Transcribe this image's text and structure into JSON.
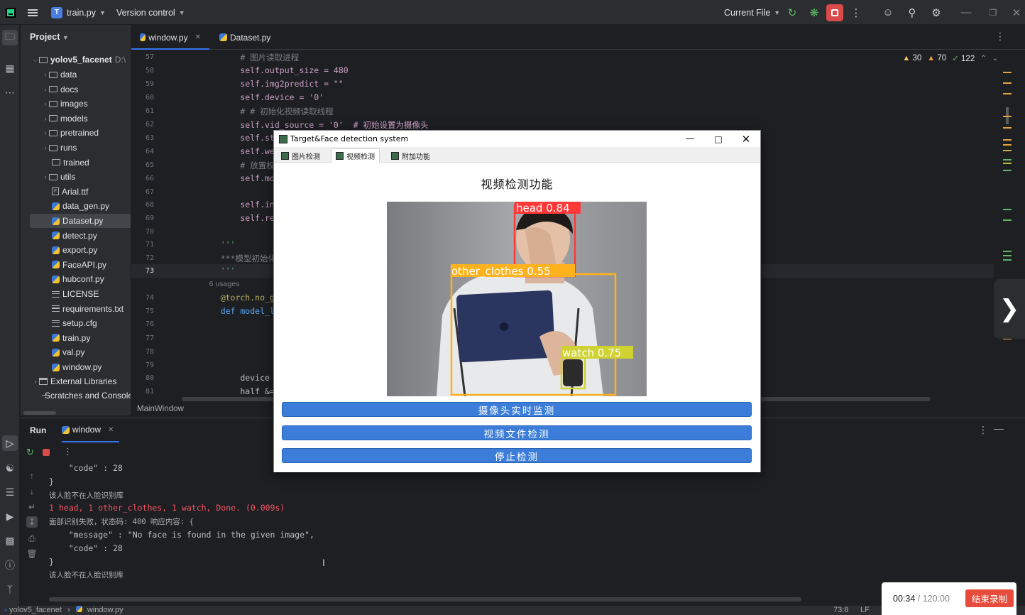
{
  "titlebar": {
    "project_badge": "T",
    "project_name": "train.py",
    "vcs": "Version control",
    "run_config": "Current File"
  },
  "project_panel": {
    "title": "Project",
    "root": {
      "name": "yolov5_facenet",
      "path": "D:\\"
    },
    "items": [
      {
        "label": "data",
        "type": "folder"
      },
      {
        "label": "docs",
        "type": "folder"
      },
      {
        "label": "images",
        "type": "folder"
      },
      {
        "label": "models",
        "type": "folder"
      },
      {
        "label": "pretrained",
        "type": "folder"
      },
      {
        "label": "runs",
        "type": "folder"
      },
      {
        "label": "trained",
        "type": "folder-noarrow"
      },
      {
        "label": "utils",
        "type": "folder"
      },
      {
        "label": "Arial.ttf",
        "type": "font"
      },
      {
        "label": "data_gen.py",
        "type": "py"
      },
      {
        "label": "Dataset.py",
        "type": "py",
        "selected": true
      },
      {
        "label": "detect.py",
        "type": "py"
      },
      {
        "label": "export.py",
        "type": "py"
      },
      {
        "label": "FaceAPI.py",
        "type": "py"
      },
      {
        "label": "hubconf.py",
        "type": "py"
      },
      {
        "label": "LICENSE",
        "type": "txt"
      },
      {
        "label": "requirements.txt",
        "type": "txt"
      },
      {
        "label": "setup.cfg",
        "type": "txt"
      },
      {
        "label": "train.py",
        "type": "py"
      },
      {
        "label": "val.py",
        "type": "py"
      },
      {
        "label": "window.py",
        "type": "py"
      }
    ],
    "external": "External Libraries",
    "scratches": "Scratches and Consoles"
  },
  "editor": {
    "tabs": [
      {
        "label": "window.py",
        "active": true
      },
      {
        "label": "Dataset.py",
        "active": false
      }
    ],
    "warnings": {
      "w1": "30",
      "w2": "70",
      "ok": "122"
    },
    "lines": [
      {
        "n": "57",
        "t": "        # 图片读取进程"
      },
      {
        "n": "58",
        "t": "        self.output_size = 480"
      },
      {
        "n": "59",
        "t": "        self.img2predict = \"\""
      },
      {
        "n": "60",
        "t": "        self.device = '0'"
      },
      {
        "n": "61",
        "t": "        # # 初始化视频读取线程"
      },
      {
        "n": "62",
        "t": "        self.vid_source = '0'  # 初始设置为摄像头"
      },
      {
        "n": "63",
        "t": "        self.stopEv"
      },
      {
        "n": "64",
        "t": "        self.webcam"
      },
      {
        "n": "65",
        "t": "        # 放置权重文件"
      },
      {
        "n": "66",
        "t": "        self.model "
      },
      {
        "n": "67",
        "t": ""
      },
      {
        "n": "68",
        "t": "        self.initUI"
      },
      {
        "n": "69",
        "t": "        self.reset_"
      },
      {
        "n": "70",
        "t": ""
      },
      {
        "n": "71",
        "t": "    '''"
      },
      {
        "n": "72",
        "t": "    ***模型初始化***"
      },
      {
        "n": "73",
        "t": "    '''"
      },
      {
        "n": "",
        "t": "    6 usages"
      },
      {
        "n": "74",
        "t": "    @torch.no_grad("
      },
      {
        "n": "75",
        "t": "    def model_load("
      },
      {
        "n": "76",
        "t": ""
      },
      {
        "n": "77",
        "t": ""
      },
      {
        "n": "78",
        "t": ""
      },
      {
        "n": "79",
        "t": ""
      },
      {
        "n": "80",
        "t": "        device = se"
      },
      {
        "n": "81",
        "t": "        half &= dev"
      }
    ],
    "breadcrumb": "MainWindow"
  },
  "run_panel": {
    "tab_run": "Run",
    "tab_window": "window",
    "console": [
      {
        "t": "    \"code\" : 28",
        "red": false
      },
      {
        "t": "}",
        "red": false
      },
      {
        "t": "该人脸不在人脸识别库",
        "red": false
      },
      {
        "t": "1 head, 1 other_clothes, 1 watch, Done. (0.009s)",
        "red": true
      },
      {
        "t": "面部识别失败，状态码: 400 响应内容: {",
        "red": false
      },
      {
        "t": "    \"message\" : \"No face is found in the given image\",",
        "red": false
      },
      {
        "t": "    \"code\" : 28",
        "red": false
      },
      {
        "t": "}",
        "red": false
      },
      {
        "t": "该人脸不在人脸识别库",
        "red": false
      }
    ]
  },
  "statusbar": {
    "crumb_project": "yolov5_facenet",
    "crumb_file": "window.py",
    "position": "73:8",
    "line_sep": "LF"
  },
  "recording": {
    "elapsed": "00:34",
    "total": "120:00",
    "stop_label": "结束录制"
  },
  "qt_window": {
    "title": "Target&Face detection system",
    "tabs": [
      "图片检测",
      "视频检测",
      "附加功能"
    ],
    "active_tab": 1,
    "heading": "视频检测功能",
    "detections": [
      {
        "label": "head 0.84",
        "color": "#ff3838"
      },
      {
        "label": "other_clothes 0.55",
        "color": "#ffb21d"
      },
      {
        "label": "watch 0.75",
        "color": "#cfd231"
      }
    ],
    "buttons": [
      "摄像头实时监测",
      "视频文件检测",
      "停止检测"
    ]
  }
}
